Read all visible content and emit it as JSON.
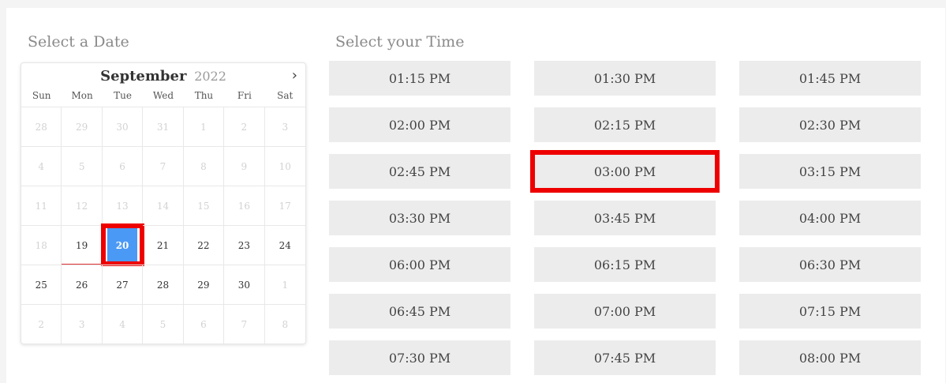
{
  "date_section": {
    "heading": "Select a Date"
  },
  "time_section": {
    "heading": "Select your Time"
  },
  "calendar": {
    "month": "September",
    "year": "2022",
    "next_icon": "chevron-right-icon",
    "weekdays": [
      "Sun",
      "Mon",
      "Tue",
      "Wed",
      "Thu",
      "Fri",
      "Sat"
    ],
    "days": [
      {
        "label": "28",
        "muted": true
      },
      {
        "label": "29",
        "muted": true
      },
      {
        "label": "30",
        "muted": true
      },
      {
        "label": "31",
        "muted": true
      },
      {
        "label": "1",
        "muted": true
      },
      {
        "label": "2",
        "muted": true
      },
      {
        "label": "3",
        "muted": true
      },
      {
        "label": "4",
        "muted": true
      },
      {
        "label": "5",
        "muted": true
      },
      {
        "label": "6",
        "muted": true
      },
      {
        "label": "7",
        "muted": true
      },
      {
        "label": "8",
        "muted": true
      },
      {
        "label": "9",
        "muted": true
      },
      {
        "label": "10",
        "muted": true
      },
      {
        "label": "11",
        "muted": true
      },
      {
        "label": "12",
        "muted": true
      },
      {
        "label": "13",
        "muted": true
      },
      {
        "label": "14",
        "muted": true
      },
      {
        "label": "15",
        "muted": true
      },
      {
        "label": "16",
        "muted": true
      },
      {
        "label": "17",
        "muted": true
      },
      {
        "label": "18",
        "muted": true
      },
      {
        "label": "19",
        "muted": false,
        "today": true
      },
      {
        "label": "20",
        "muted": false,
        "selected": true
      },
      {
        "label": "21",
        "muted": false
      },
      {
        "label": "22",
        "muted": false
      },
      {
        "label": "23",
        "muted": false
      },
      {
        "label": "24",
        "muted": false
      },
      {
        "label": "25",
        "muted": false
      },
      {
        "label": "26",
        "muted": false
      },
      {
        "label": "27",
        "muted": false
      },
      {
        "label": "28",
        "muted": false
      },
      {
        "label": "29",
        "muted": false
      },
      {
        "label": "30",
        "muted": false
      },
      {
        "label": "1",
        "muted": true
      },
      {
        "label": "2",
        "muted": true
      },
      {
        "label": "3",
        "muted": true
      },
      {
        "label": "4",
        "muted": true
      },
      {
        "label": "5",
        "muted": true
      },
      {
        "label": "6",
        "muted": true
      },
      {
        "label": "7",
        "muted": true
      },
      {
        "label": "8",
        "muted": true
      }
    ],
    "selected_color": "#4a9af5"
  },
  "time_slots": [
    {
      "label": "01:15 PM"
    },
    {
      "label": "01:30 PM"
    },
    {
      "label": "01:45 PM"
    },
    {
      "label": "02:00 PM"
    },
    {
      "label": "02:15 PM"
    },
    {
      "label": "02:30 PM"
    },
    {
      "label": "02:45 PM"
    },
    {
      "label": "03:00 PM",
      "highlighted": true
    },
    {
      "label": "03:15 PM"
    },
    {
      "label": "03:30 PM"
    },
    {
      "label": "03:45 PM"
    },
    {
      "label": "04:00 PM"
    },
    {
      "label": "06:00 PM"
    },
    {
      "label": "06:15 PM"
    },
    {
      "label": "06:30 PM"
    },
    {
      "label": "06:45 PM"
    },
    {
      "label": "07:00 PM"
    },
    {
      "label": "07:15 PM"
    },
    {
      "label": "07:30 PM"
    },
    {
      "label": "07:45 PM"
    },
    {
      "label": "08:00 PM"
    }
  ],
  "highlight_color": "#ee0000"
}
